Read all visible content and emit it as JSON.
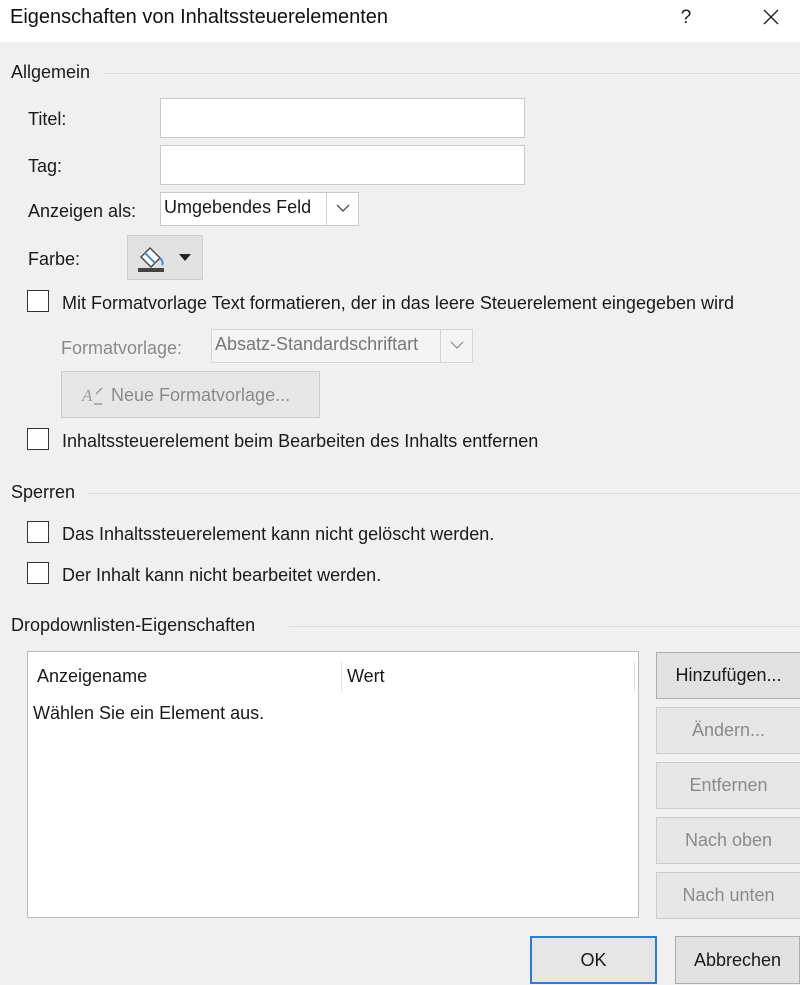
{
  "window": {
    "title": "Eigenschaften von Inhaltssteuerelementen",
    "help_label": "?",
    "close_icon": "close-icon"
  },
  "general": {
    "section_title": "Allgemein",
    "title_label": "Titel:",
    "title_value": "",
    "tag_label": "Tag:",
    "tag_value": "",
    "display_as_label": "Anzeigen als:",
    "display_as_value": "Umgebendes Feld",
    "color_label": "Farbe:",
    "color_icon": "paint-bucket-icon",
    "format_checkbox_label": "Mit Formatvorlage Text formatieren, der in das leere Steuerelement eingegeben wird",
    "format_checkbox_checked": false,
    "style_label": "Formatvorlage:",
    "style_value": "Absatz-Standardschriftart",
    "new_style_button": "Neue Formatvorlage...",
    "remove_checkbox_label": "Inhaltssteuerelement beim Bearbeiten des Inhalts entfernen",
    "remove_checkbox_checked": false
  },
  "locking": {
    "section_title": "Sperren",
    "no_delete_label": "Das Inhaltssteuerelement kann nicht gelöscht werden.",
    "no_delete_checked": false,
    "no_edit_label": "Der Inhalt kann nicht bearbeitet werden.",
    "no_edit_checked": false
  },
  "dropdown": {
    "section_title": "Dropdownlisten-Eigenschaften",
    "columns": [
      "Anzeigename",
      "Wert"
    ],
    "rows": [
      {
        "display_name": "Wählen Sie ein Element aus.",
        "value": ""
      }
    ],
    "buttons": {
      "add": "Hinzufügen...",
      "modify": "Ändern...",
      "remove": "Entfernen",
      "move_up": "Nach oben",
      "move_down": "Nach unten"
    }
  },
  "footer": {
    "ok": "OK",
    "cancel": "Abbrechen"
  },
  "colors": {
    "accent_focus": "#2f7bd1",
    "background": "#f0f0f0"
  }
}
